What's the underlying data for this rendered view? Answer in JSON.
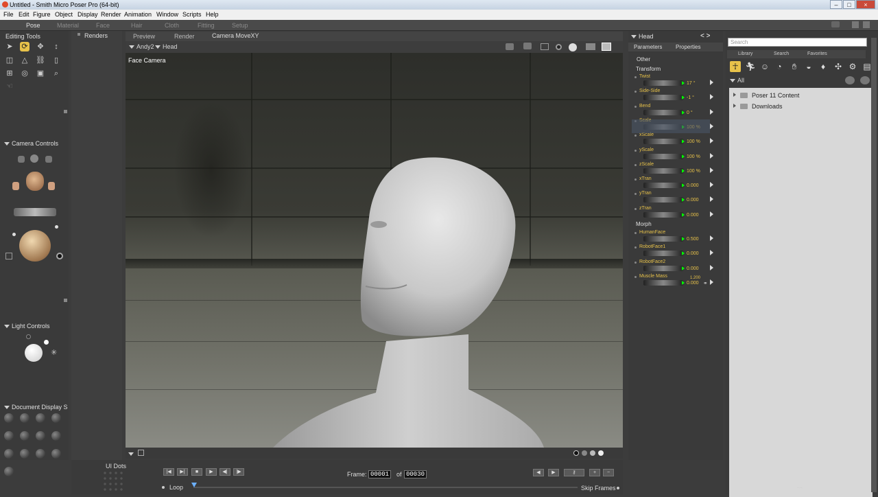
{
  "window": {
    "title": "Untitled - Smith Micro Poser Pro  (64-bit)",
    "minimize": "–",
    "maximize": "□",
    "close": "×"
  },
  "menu": [
    "File",
    "Edit",
    "Figure",
    "Object",
    "Display",
    "Render",
    "Animation",
    "Window",
    "Scripts",
    "Help"
  ],
  "rooms": [
    {
      "label": "Pose",
      "active": true
    },
    {
      "label": "Material",
      "active": false
    },
    {
      "label": "Face",
      "active": false
    },
    {
      "label": "Hair",
      "active": false
    },
    {
      "label": "Cloth",
      "active": false
    },
    {
      "label": "Fitting",
      "active": false
    },
    {
      "label": "Setup",
      "active": false
    }
  ],
  "left": {
    "editing_tools": "Editing Tools",
    "camera_controls": "Camera Controls",
    "light_controls": "Light Controls",
    "doc_display": "Document Display S"
  },
  "renders": {
    "label": "Renders"
  },
  "viewport": {
    "tabs": [
      "Preview",
      "Render",
      "Camera MoveXY"
    ],
    "figure_select": "Andy2",
    "part_select": "Head",
    "camera_label": "Face Camera"
  },
  "params": {
    "actor": "Head",
    "tabs": [
      "Parameters",
      "Properties"
    ],
    "groups": {
      "other": "Other",
      "transform": "Transform",
      "morph": "Morph"
    },
    "transform": [
      {
        "name": "Twist",
        "value": "17 °"
      },
      {
        "name": "Side-Side",
        "value": "-1 °"
      },
      {
        "name": "Bend",
        "value": "0 °"
      },
      {
        "name": "Scale",
        "value": "100 %"
      },
      {
        "name": "xScale",
        "value": "100 %"
      },
      {
        "name": "yScale",
        "value": "100 %"
      },
      {
        "name": "zScale",
        "value": "100 %"
      },
      {
        "name": "xTran",
        "value": "0.000"
      },
      {
        "name": "yTran",
        "value": "0.000"
      },
      {
        "name": "zTran",
        "value": "0.000"
      }
    ],
    "morphs": [
      {
        "name": "HumanFace",
        "value": "0.500"
      },
      {
        "name": "RobotFace1",
        "value": "0.000"
      },
      {
        "name": "RobotFace2",
        "value": "0.000"
      },
      {
        "name": "Muscle Mass",
        "value": "0.000",
        "extra": "1.200"
      }
    ]
  },
  "library": {
    "search_placeholder": "Search",
    "tabs": [
      "Library",
      "Search",
      "Favorites"
    ],
    "filter": "All",
    "items": [
      "Poser 11 Content",
      "Downloads"
    ],
    "footer": "..."
  },
  "timeline": {
    "ui_dots": "UI Dots",
    "frame_label": "Frame:",
    "frame": "00001",
    "of_label": "of",
    "total": "00030",
    "loop": "Loop",
    "skip": "Skip Frames"
  }
}
